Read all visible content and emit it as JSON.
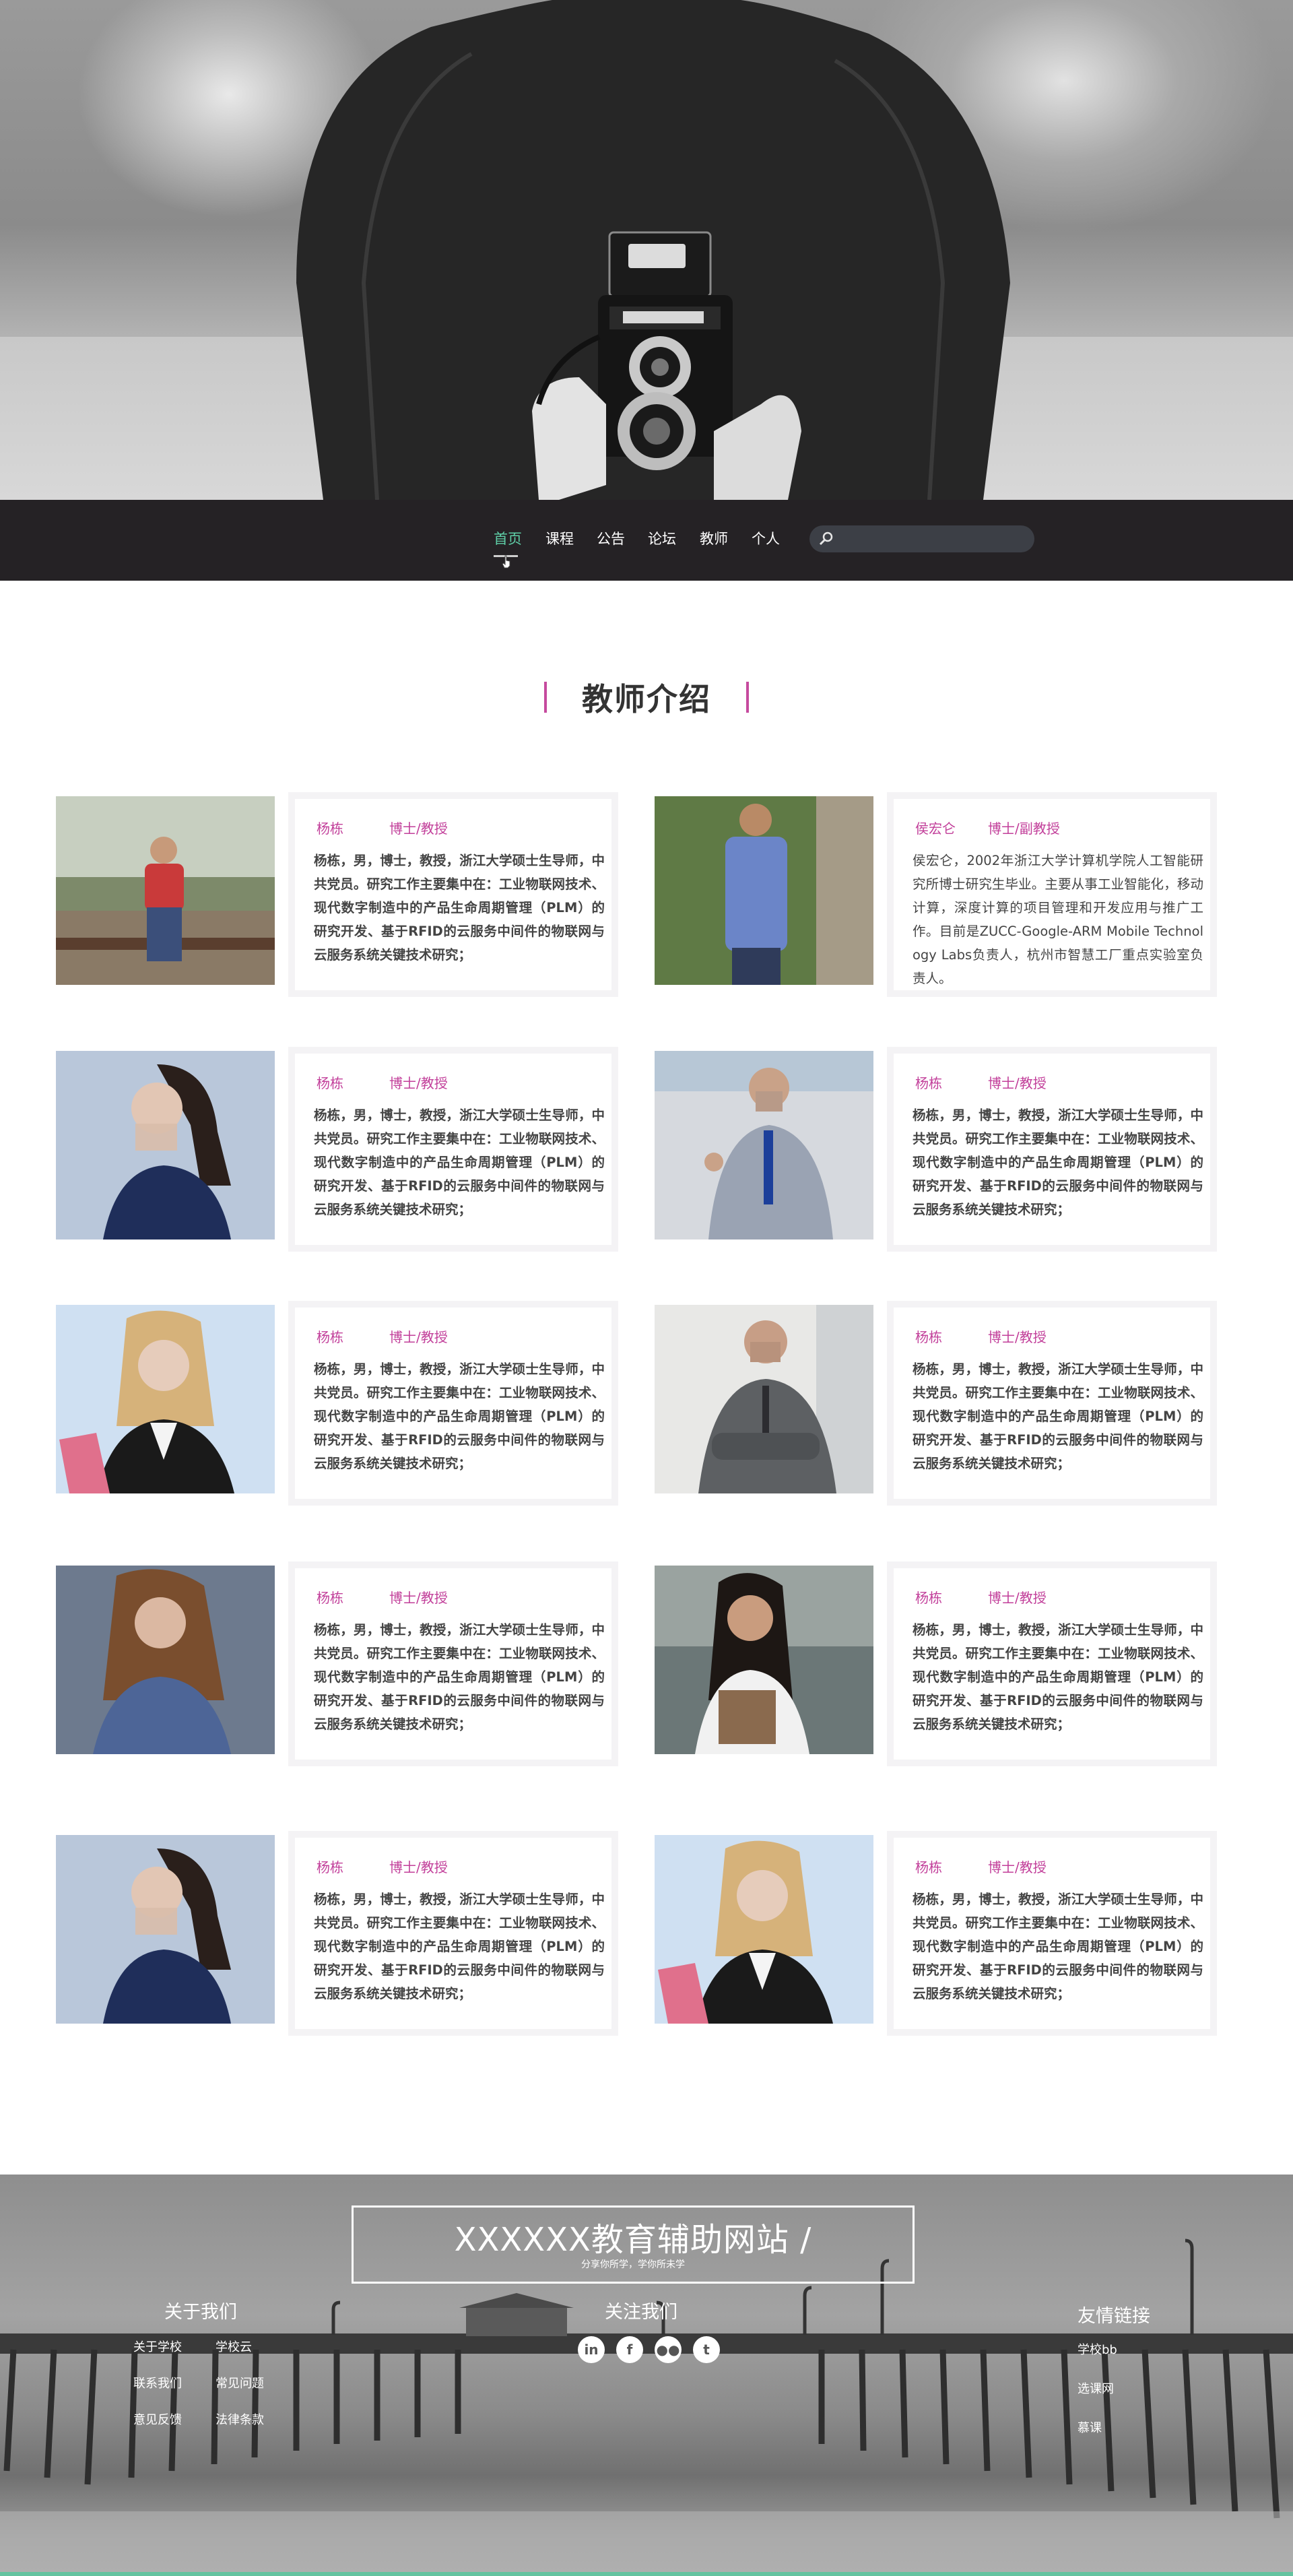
{
  "nav": {
    "items": [
      {
        "label": "首页",
        "active": true
      },
      {
        "label": "课程"
      },
      {
        "label": "公告"
      },
      {
        "label": "论坛"
      },
      {
        "label": "教师"
      },
      {
        "label": "个人"
      }
    ],
    "search_placeholder": ""
  },
  "section": {
    "title": "教师介绍"
  },
  "teachers": [
    {
      "name": "杨栋",
      "degree": "博士/教授",
      "desc": "杨栋，男，博士，教授，浙江大学硕士生导师，中共党员。研究工作主要集中在：工业物联网技术、现代数字制造中的产品生命周期管理（PLM）的研究开发、基于RFID的云服务中间件的物联网与云服务系统关键技术研究；",
      "photo": "man-on-bench"
    },
    {
      "name": "侯宏仑",
      "degree": "博士/副教授",
      "desc": "侯宏仑，2002年浙江大学计算机学院人工智能研究所博士研究生毕业。主要从事工业智能化，移动计算，深度计算的项目管理和开发应用与推广工作。目前是ZUCC-Google-ARM Mobile Technology Labs负责人，杭州市智慧工厂重点实验室负责人。",
      "photo": "man-with-backpack"
    },
    {
      "name": "杨栋",
      "degree": "博士/教授",
      "desc": "杨栋，男，博士，教授，浙江大学硕士生导师，中共党员。研究工作主要集中在：工业物联网技术、现代数字制造中的产品生命周期管理（PLM）的研究开发、基于RFID的云服务中间件的物联网与云服务系统关键技术研究；",
      "photo": "woman-ponytail"
    },
    {
      "name": "杨栋",
      "degree": "博士/教授",
      "desc": "杨栋，男，博士，教授，浙江大学硕士生导师，中共党员。研究工作主要集中在：工业物联网技术、现代数字制造中的产品生命周期管理（PLM）的研究开发、基于RFID的云服务中间件的物联网与云服务系统关键技术研究；",
      "photo": "man-thumbs-up"
    },
    {
      "name": "杨栋",
      "degree": "博士/教授",
      "desc": "杨栋，男，博士，教授，浙江大学硕士生导师，中共党员。研究工作主要集中在：工业物联网技术、现代数字制造中的产品生命周期管理（PLM）的研究开发、基于RFID的云服务中间件的物联网与云服务系统关键技术研究；",
      "photo": "blonde-woman-folder"
    },
    {
      "name": "杨栋",
      "degree": "博士/教授",
      "desc": "杨栋，男，博士，教授，浙江大学硕士生导师，中共党员。研究工作主要集中在：工业物联网技术、现代数字制造中的产品生命周期管理（PLM）的研究开发、基于RFID的云服务中间件的物联网与云服务系统关键技术研究；",
      "photo": "man-arms-crossed"
    },
    {
      "name": "杨栋",
      "degree": "博士/教授",
      "desc": "杨栋，男，博士，教授，浙江大学硕士生导师，中共党员。研究工作主要集中在：工业物联网技术、现代数字制造中的产品生命周期管理（PLM）的研究开发、基于RFID的云服务中间件的物联网与云服务系统关键技术研究；",
      "photo": "woman-curly-hair"
    },
    {
      "name": "杨栋",
      "degree": "博士/教授",
      "desc": "杨栋，男，博士，教授，浙江大学硕士生导师，中共党员。研究工作主要集中在：工业物联网技术、现代数字制造中的产品生命周期管理（PLM）的研究开发、基于RFID的云服务中间件的物联网与云服务系统关键技术研究；",
      "photo": "woman-with-notebook"
    },
    {
      "name": "杨栋",
      "degree": "博士/教授",
      "desc": "杨栋，男，博士，教授，浙江大学硕士生导师，中共党员。研究工作主要集中在：工业物联网技术、现代数字制造中的产品生命周期管理（PLM）的研究开发、基于RFID的云服务中间件的物联网与云服务系统关键技术研究；",
      "photo": "woman-ponytail"
    },
    {
      "name": "杨栋",
      "degree": "博士/教授",
      "desc": "杨栋，男，博士，教授，浙江大学硕士生导师，中共党员。研究工作主要集中在：工业物联网技术、现代数字制造中的产品生命周期管理（PLM）的研究开发、基于RFID的云服务中间件的物联网与云服务系统关键技术研究；",
      "photo": "blonde-woman-folder"
    }
  ],
  "footer": {
    "brand": "XXXXXX教育辅助网站 /",
    "slogan": "分享你所学，学你所未学",
    "about": {
      "title": "关于我们",
      "links": [
        "关于学校",
        "学校云",
        "联系我们",
        "常见问题",
        "意见反馈",
        "法律条款"
      ]
    },
    "follow": {
      "title": "关注我们",
      "icons": [
        "linkedin-icon",
        "facebook-icon",
        "flickr-icon",
        "twitter-icon"
      ]
    },
    "friends": {
      "title": "友情链接",
      "links": [
        "学校bb",
        "选课网",
        "慕课"
      ]
    }
  },
  "colors": {
    "accent": "#c23f9a",
    "nav_bg": "#252225",
    "nav_active": "#5fd0a8",
    "footer_line": "#64c4a0"
  }
}
